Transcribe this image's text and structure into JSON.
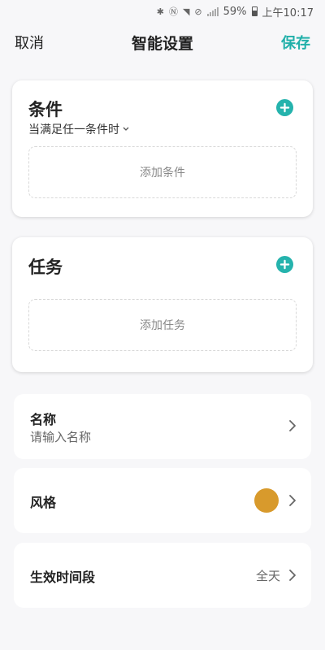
{
  "status_bar": {
    "battery_percent": "59%",
    "time": "上午10:17"
  },
  "nav": {
    "cancel_label": "取消",
    "title": "智能设置",
    "save_label": "保存"
  },
  "condition_card": {
    "title": "条件",
    "match_mode": "当满足任一条件时",
    "add_label": "添加条件"
  },
  "task_card": {
    "title": "任务",
    "add_label": "添加任务"
  },
  "name_row": {
    "label": "名称",
    "placeholder": "请输入名称"
  },
  "style_row": {
    "label": "风格",
    "color": "#d89a2c"
  },
  "time_row": {
    "label": "生效时间段",
    "value": "全天"
  },
  "colors": {
    "accent": "#25b3ad",
    "save": "#22b0aa"
  }
}
